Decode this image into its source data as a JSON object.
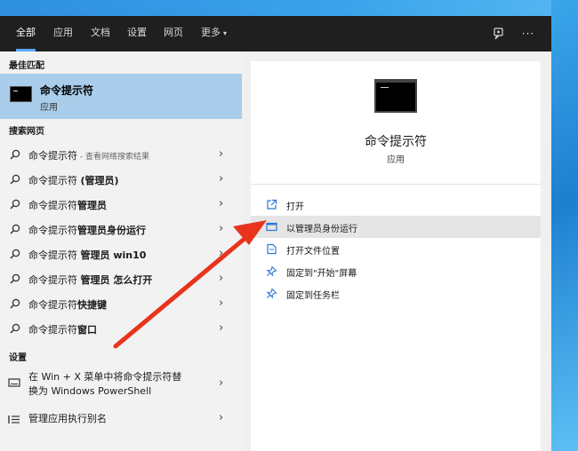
{
  "header": {
    "tabs": [
      {
        "label": "全部"
      },
      {
        "label": "应用"
      },
      {
        "label": "文档"
      },
      {
        "label": "设置"
      },
      {
        "label": "网页"
      },
      {
        "label": "更多"
      }
    ],
    "more_caret": "▾",
    "more_options_glyph": "···"
  },
  "left": {
    "best_match_title": "最佳匹配",
    "best": {
      "title": "命令提示符",
      "subtitle": "应用"
    },
    "web_title": "搜索网页",
    "web_results": [
      {
        "text": "命令提示符",
        "hint": " - 查看网络搜索结果"
      },
      {
        "text": "命令提示符 ",
        "bold": "(管理员)"
      },
      {
        "text": "命令提示符",
        "bold": "管理员"
      },
      {
        "text": "命令提示符",
        "bold": "管理员身份运行"
      },
      {
        "text": "命令提示符 ",
        "bold": "管理员 win10"
      },
      {
        "text": "命令提示符 ",
        "bold": "管理员 怎么打开"
      },
      {
        "text": "命令提示符",
        "bold": "快捷键"
      },
      {
        "text": "命令提示符",
        "bold": "窗口"
      }
    ],
    "settings_title": "设置",
    "settings": [
      {
        "line1": "在 Win + X 菜单中将命令提示符替",
        "line2": "换为 Windows PowerShell"
      },
      {
        "line1": "管理应用执行别名"
      }
    ],
    "chevron": "›"
  },
  "right": {
    "app_name": "命令提示符",
    "app_type": "应用",
    "actions": [
      {
        "label": "打开",
        "icon": "open-icon"
      },
      {
        "label": "以管理员身份运行",
        "icon": "run-as-admin-icon"
      },
      {
        "label": "打开文件位置",
        "icon": "file-location-icon"
      },
      {
        "label": "固定到\"开始\"屏幕",
        "icon": "pin-start-icon"
      },
      {
        "label": "固定到任务栏",
        "icon": "pin-taskbar-icon"
      }
    ]
  },
  "colors": {
    "accent": "#5aa7ff",
    "header_bg": "#1f1f1f",
    "selected_bg": "#a9cdea",
    "hover_bg": "#e5e5e5",
    "action_icon": "#2b78d6",
    "annotation_arrow": "#e8341c"
  }
}
